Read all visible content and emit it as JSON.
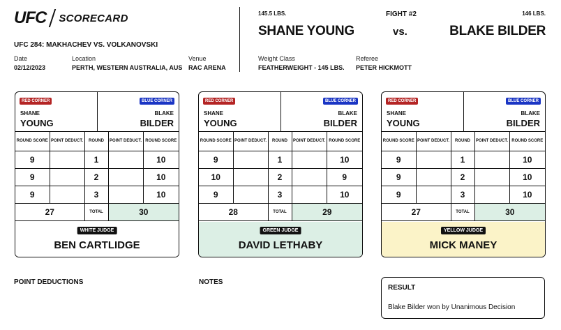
{
  "header": {
    "logo_brand": "UFC",
    "logo_text": "SCORECARD",
    "event": "UFC 284: MAKHACHEV VS. VOLKANOVSKI",
    "date_label": "Date",
    "date": "02/12/2023",
    "location_label": "Location",
    "location": "PERTH, WESTERN AUSTRALIA, AUS",
    "venue_label": "Venue",
    "venue": "RAC ARENA",
    "weight_class_label": "Weight Class",
    "weight_class": "FEATHERWEIGHT - 145 LBS.",
    "referee_label": "Referee",
    "referee": "PETER HICKMOTT"
  },
  "fight": {
    "number": "FIGHT #2",
    "vs": "vs.",
    "red_weight": "145.5 LBS.",
    "red_name": "SHANE YOUNG",
    "blue_weight": "146 LBS.",
    "blue_name": "BLAKE BILDER"
  },
  "labels": {
    "red_corner": "RED CORNER",
    "blue_corner": "BLUE CORNER",
    "round_score": "ROUND SCORE",
    "point_deduct": "POINT DEDUCT.",
    "round": "ROUND",
    "total": "TOTAL"
  },
  "cards": [
    {
      "red_first": "SHANE",
      "red_last": "YOUNG",
      "blue_first": "BLAKE",
      "blue_last": "BILDER",
      "rounds": [
        {
          "red_score": "9",
          "red_deduct": "",
          "round": "1",
          "blue_deduct": "",
          "blue_score": "10"
        },
        {
          "red_score": "9",
          "red_deduct": "",
          "round": "2",
          "blue_deduct": "",
          "blue_score": "10"
        },
        {
          "red_score": "9",
          "red_deduct": "",
          "round": "3",
          "blue_deduct": "",
          "blue_score": "10"
        }
      ],
      "red_total": "27",
      "blue_total": "30",
      "judge_tag": "WHITE JUDGE",
      "judge_name": "BEN CARTLIDGE",
      "judge_color": "#ffffff"
    },
    {
      "red_first": "SHANE",
      "red_last": "YOUNG",
      "blue_first": "BLAKE",
      "blue_last": "BILDER",
      "rounds": [
        {
          "red_score": "9",
          "red_deduct": "",
          "round": "1",
          "blue_deduct": "",
          "blue_score": "10"
        },
        {
          "red_score": "10",
          "red_deduct": "",
          "round": "2",
          "blue_deduct": "",
          "blue_score": "9"
        },
        {
          "red_score": "9",
          "red_deduct": "",
          "round": "3",
          "blue_deduct": "",
          "blue_score": "10"
        }
      ],
      "red_total": "28",
      "blue_total": "29",
      "judge_tag": "GREEN JUDGE",
      "judge_name": "DAVID LETHABY",
      "judge_color": "#dcefe5"
    },
    {
      "red_first": "SHANE",
      "red_last": "YOUNG",
      "blue_first": "BLAKE",
      "blue_last": "BILDER",
      "rounds": [
        {
          "red_score": "9",
          "red_deduct": "",
          "round": "1",
          "blue_deduct": "",
          "blue_score": "10"
        },
        {
          "red_score": "9",
          "red_deduct": "",
          "round": "2",
          "blue_deduct": "",
          "blue_score": "10"
        },
        {
          "red_score": "9",
          "red_deduct": "",
          "round": "3",
          "blue_deduct": "",
          "blue_score": "10"
        }
      ],
      "red_total": "27",
      "blue_total": "30",
      "judge_tag": "YELLOW JUDGE",
      "judge_name": "MICK MANEY",
      "judge_color": "#fbf3c8"
    }
  ],
  "bottom": {
    "point_deductions_title": "POINT DEDUCTIONS",
    "notes_title": "NOTES",
    "result_title": "RESULT",
    "result_text": "Blake Bilder won by Unanimous Decision"
  },
  "colors": {
    "red_corner": "#b42424",
    "blue_corner": "#1a35c4",
    "total_highlight": "#dcefe5"
  }
}
